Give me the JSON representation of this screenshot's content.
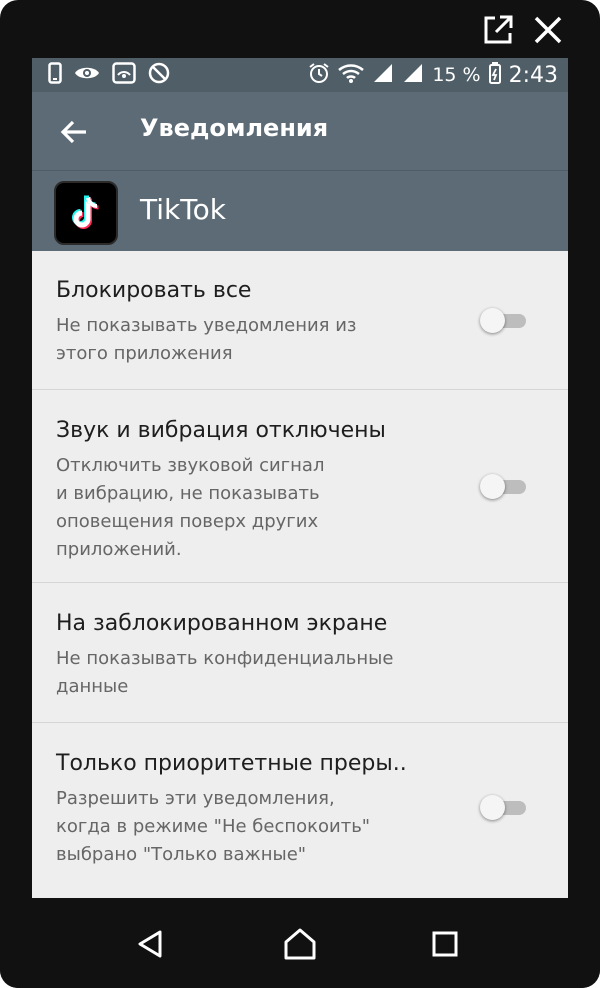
{
  "status_bar": {
    "battery_percent": "15 %",
    "time": "2:43",
    "icons": [
      "phone-icon",
      "eye-icon",
      "cast-icon",
      "data-saver-icon",
      "alarm-icon",
      "wifi-icon",
      "signal-icon",
      "signal-icon-2",
      "battery-icon"
    ]
  },
  "app_bar": {
    "title": "Уведомления"
  },
  "app": {
    "name": "TikTok"
  },
  "settings": {
    "items": [
      {
        "title": "Блокировать все",
        "subtitle": "Не показывать уведомления из\nэтого приложения",
        "enabled": false
      },
      {
        "title": "Звук и вибрация отключены",
        "subtitle": "Отключить звуковой сигнал\nи вибрацию, не показывать\nоповещения поверх других\nприложений.",
        "enabled": false
      },
      {
        "title": "На заблокированном экране",
        "subtitle": "Не показывать конфиденциальные\nданные"
      },
      {
        "title": "Только приоритетные преры..",
        "subtitle": "Разрешить эти уведомления,\nкогда в режиме \"Не беспокоить\"\nвыбрано \"Только важные\"",
        "enabled": false
      }
    ]
  },
  "colors": {
    "header": "#5c6b75",
    "status": "#505e67",
    "background": "#eeeeee"
  }
}
